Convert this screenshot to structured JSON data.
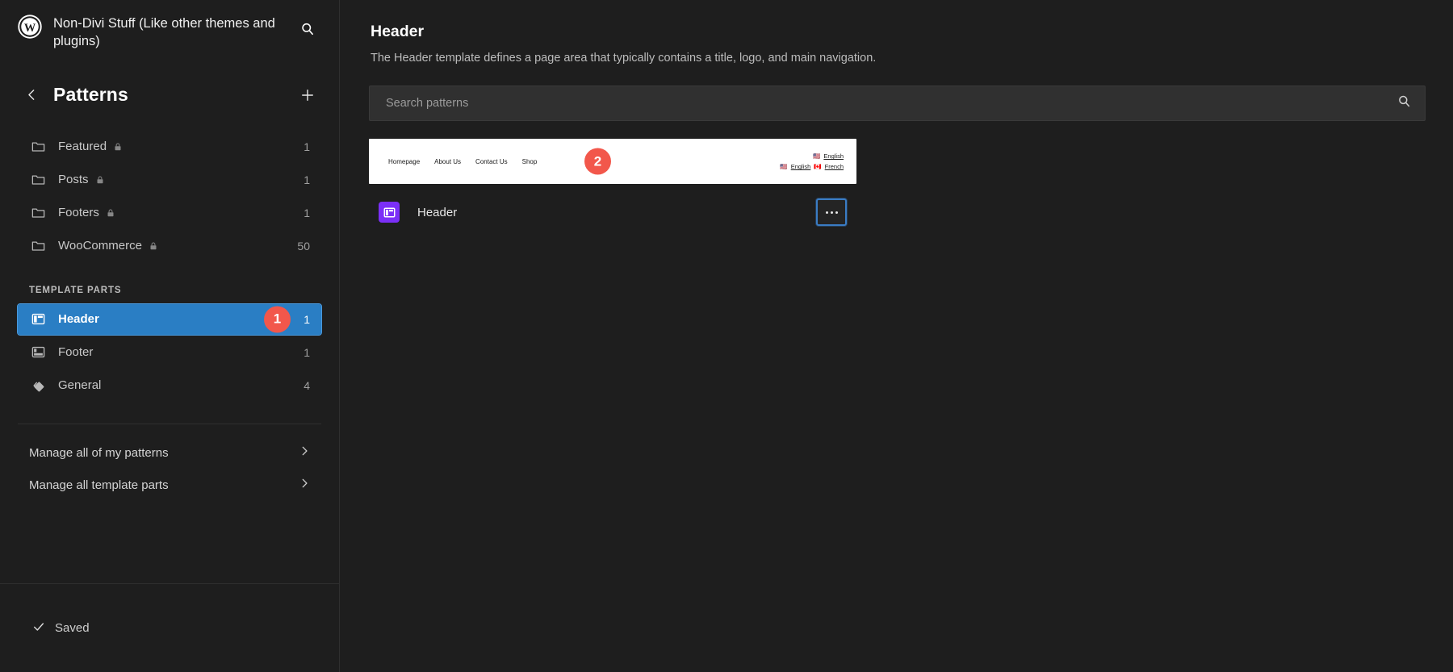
{
  "sidebar": {
    "site_title": "Non-Divi Stuff (Like other themes and plugins)",
    "search_icon": "search-icon",
    "logo_icon": "wordpress-logo-icon",
    "back_icon": "chevron-left-icon",
    "panel_title": "Patterns",
    "add_icon": "plus-icon",
    "categories": [
      {
        "label": "Featured",
        "count": "1",
        "locked": true,
        "icon": "folder-icon"
      },
      {
        "label": "Posts",
        "count": "1",
        "locked": true,
        "icon": "folder-icon"
      },
      {
        "label": "Footers",
        "count": "1",
        "locked": true,
        "icon": "folder-icon"
      },
      {
        "label": "WooCommerce",
        "count": "50",
        "locked": true,
        "icon": "folder-icon"
      }
    ],
    "section_label": "TEMPLATE PARTS",
    "template_parts": [
      {
        "label": "Header",
        "count": "1",
        "icon": "header-layout-icon",
        "selected": true
      },
      {
        "label": "Footer",
        "count": "1",
        "icon": "footer-layout-icon",
        "selected": false
      },
      {
        "label": "General",
        "count": "4",
        "icon": "layers-diamond-icon",
        "selected": false
      }
    ],
    "manage_links": [
      {
        "label": "Manage all of my patterns",
        "icon": "chevron-right-icon"
      },
      {
        "label": "Manage all template parts",
        "icon": "chevron-right-icon"
      }
    ],
    "footer": {
      "saved_label": "Saved",
      "saved_icon": "check-icon"
    }
  },
  "main": {
    "title": "Header",
    "description": "The Header template defines a page area that typically contains a title, logo, and main navigation.",
    "search": {
      "placeholder": "Search patterns",
      "value": "",
      "icon": "search-icon"
    },
    "preview": {
      "nav_items": [
        "Homepage",
        "About Us",
        "Contact Us",
        "Shop"
      ],
      "lang_rows": [
        {
          "items": [
            {
              "flag": "🇺🇸",
              "label": "English"
            }
          ]
        },
        {
          "items": [
            {
              "flag": "🇺🇸",
              "label": "English"
            },
            {
              "flag": "🇨🇦",
              "label": "French"
            }
          ]
        }
      ]
    },
    "item": {
      "label": "Header",
      "icon": "template-part-icon",
      "menu_icon": "ellipsis-icon"
    }
  },
  "annotations": [
    {
      "number": "1",
      "color": "#f2574b"
    },
    {
      "number": "2",
      "color": "#f2574b"
    }
  ]
}
